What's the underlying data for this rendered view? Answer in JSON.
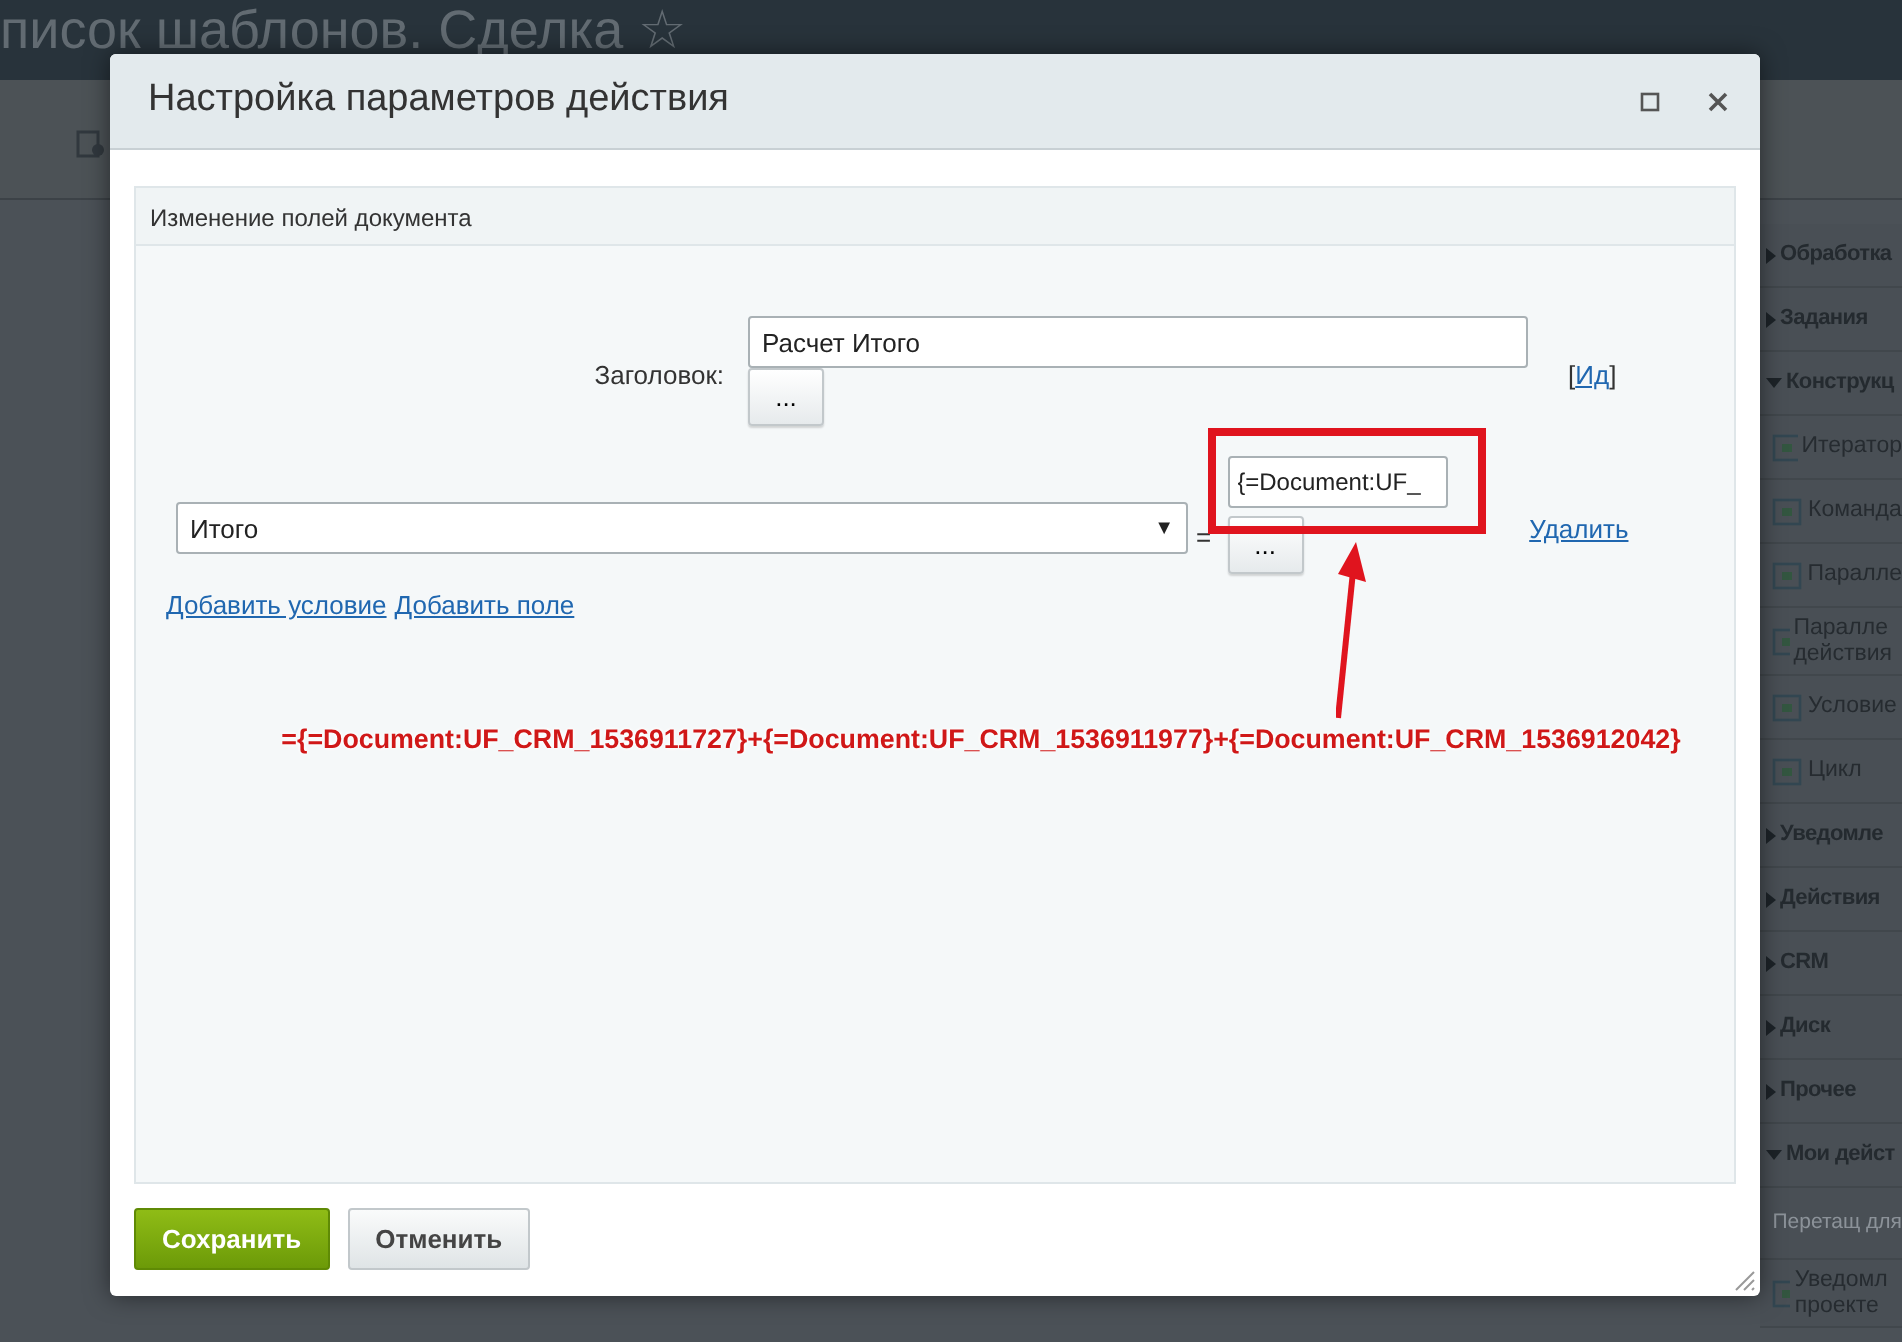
{
  "background": {
    "page_title": "писок шаблонов. Сделка",
    "star": "☆",
    "sidebar": [
      {
        "kind": "section",
        "text": "Обработка",
        "expanded": false
      },
      {
        "kind": "section",
        "text": "Задания",
        "expanded": false
      },
      {
        "kind": "section",
        "text": "Конструкц",
        "expanded": true
      },
      {
        "kind": "item",
        "text": "Итератор"
      },
      {
        "kind": "item",
        "text": "Команда"
      },
      {
        "kind": "item",
        "text": "Паралле"
      },
      {
        "kind": "item",
        "text": "Паралле действия"
      },
      {
        "kind": "item",
        "text": "Условие"
      },
      {
        "kind": "item",
        "text": "Цикл"
      },
      {
        "kind": "section",
        "text": "Уведомле",
        "expanded": false
      },
      {
        "kind": "section",
        "text": "Действия",
        "expanded": false
      },
      {
        "kind": "section",
        "text": "CRM",
        "expanded": false
      },
      {
        "kind": "section",
        "text": "Диск",
        "expanded": false
      },
      {
        "kind": "section",
        "text": "Прочее",
        "expanded": false
      },
      {
        "kind": "section",
        "text": "Мои дейст",
        "expanded": true
      },
      {
        "kind": "hint",
        "text": "Перетащ для"
      },
      {
        "kind": "item",
        "text": "Уведомл проекте"
      }
    ]
  },
  "dialog": {
    "title": "Настройка параметров действия",
    "panel_title": "Изменение полей документа",
    "title_field": {
      "label": "Заголовок:",
      "value": "Расчет Итого",
      "button": "...",
      "link_before": "[",
      "link": "Ид",
      "link_after": "]"
    },
    "fields": [
      {
        "field": "Итого",
        "arrow": "▼",
        "equals": "=",
        "value": "{=Document:UF_",
        "button": "...",
        "delete": "Удалить"
      }
    ],
    "links": [
      "Добавить условие",
      "Добавить поле"
    ],
    "annotation": "={=Document:UF_CRM_1536911727}+{=Document:UF_CRM_1536911977}+{=Document:UF_CRM_1536912042}",
    "buttons": [
      {
        "label": "Сохранить",
        "kind": "primary"
      },
      {
        "label": "Отменить",
        "kind": "secondary"
      }
    ]
  }
}
